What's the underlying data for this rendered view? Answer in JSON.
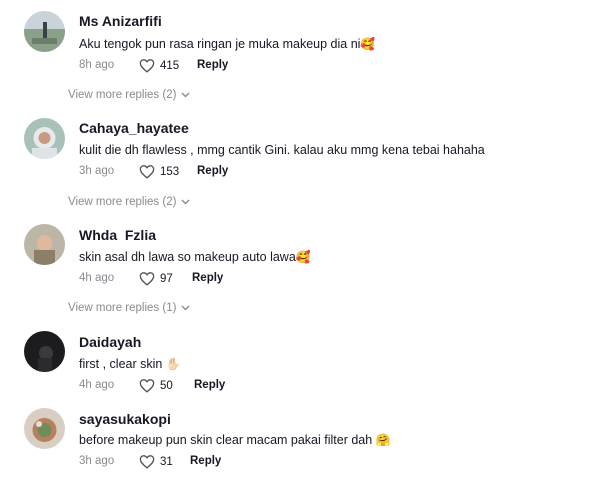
{
  "comments": [
    {
      "username": "Ms Anizarfifi",
      "text": "Aku tengok pun rasa ringan je muka makeup dia ni",
      "emoji": "🥰",
      "time": "8h ago",
      "likes": "415",
      "reply_label": "Reply",
      "view_more": "View more replies (2)"
    },
    {
      "username": "Cahaya_hayatee",
      "text": "kulit die dh flawless , mmg cantik Gini. kalau aku mmg kena tebai hahaha",
      "emoji": "",
      "time": "3h ago",
      "likes": "153",
      "reply_label": "Reply",
      "view_more": "View more replies (2)"
    },
    {
      "username": "Whda  Fzlia",
      "text": "skin asal dh lawa so makeup auto lawa",
      "emoji": "🥰",
      "time": "4h ago",
      "likes": "97",
      "reply_label": "Reply",
      "view_more": "View more replies (1)"
    },
    {
      "username": "Daidayah",
      "text": "first , clear skin ",
      "emoji": "✋🏻",
      "time": "4h ago",
      "likes": "50",
      "reply_label": "Reply",
      "view_more": ""
    },
    {
      "username": "sayasukakopi",
      "text": "before makeup pun skin clear macam pakai filter dah ",
      "emoji": "🤗",
      "time": "3h ago",
      "likes": "31",
      "reply_label": "Reply",
      "view_more": ""
    }
  ],
  "icons": {
    "like": "heart-outline-icon",
    "expand": "chevron-down-icon"
  },
  "colors": {
    "text": "#161823",
    "secondary": "#8a8b91"
  }
}
